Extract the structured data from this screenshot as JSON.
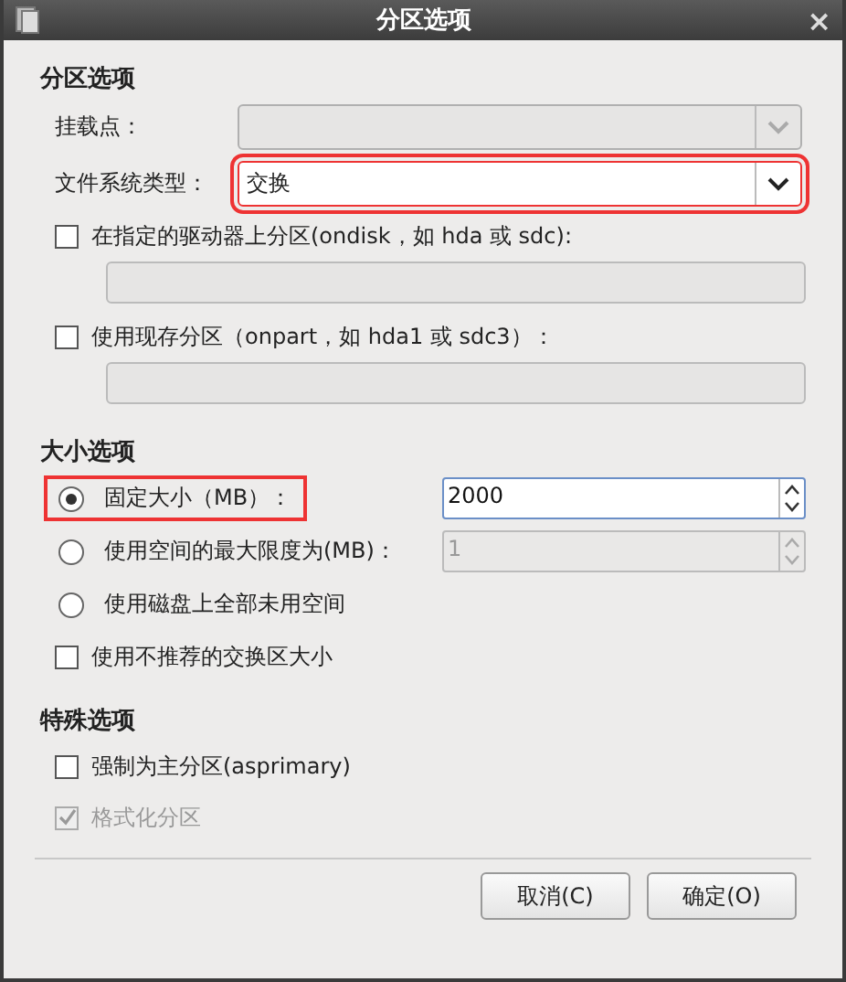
{
  "window": {
    "title": "分区选项",
    "close": "×"
  },
  "sections": [
    {
      "heading": "分区选项",
      "items": [
        {
          "kind": "combo",
          "label": "挂载点：",
          "disabled": true,
          "highlighted": false
        },
        {
          "kind": "combo",
          "label": "文件系统类型：",
          "value": "交换",
          "disabled": false,
          "highlighted": true
        },
        {
          "kind": "checkbox",
          "label": "在指定的驱动器上分区(ondisk，如 hda 或 sdc):",
          "checked": false,
          "disabled": false,
          "field": true
        },
        {
          "kind": "checkbox",
          "label": "使用现存分区（onpart，如 hda1 或 sdc3）：",
          "checked": false,
          "disabled": false,
          "field": true
        }
      ]
    },
    {
      "heading": "大小选项",
      "items": [
        {
          "kind": "radio",
          "label": "固定大小（MB）：",
          "selected": true,
          "highlighted": true,
          "spin": {
            "value": "2000",
            "disabled": false
          }
        },
        {
          "kind": "radio",
          "label": "使用空间的最大限度为(MB)：",
          "selected": false,
          "highlighted": false,
          "spin": {
            "value": "1",
            "disabled": true
          }
        },
        {
          "kind": "radio",
          "label": "使用磁盘上全部未用空间",
          "selected": false,
          "highlighted": false
        },
        {
          "kind": "checkbox",
          "label": "使用不推荐的交换区大小",
          "checked": false,
          "disabled": false,
          "field": false
        }
      ]
    },
    {
      "heading": "特殊选项",
      "items": [
        {
          "kind": "checkbox",
          "label": "强制为主分区(asprimary)",
          "checked": false,
          "disabled": false,
          "field": false
        },
        {
          "kind": "checkbox",
          "label": "格式化分区",
          "checked": true,
          "disabled": true,
          "field": false
        }
      ]
    }
  ],
  "buttons": [
    "取消(C)",
    "确定(O)"
  ]
}
